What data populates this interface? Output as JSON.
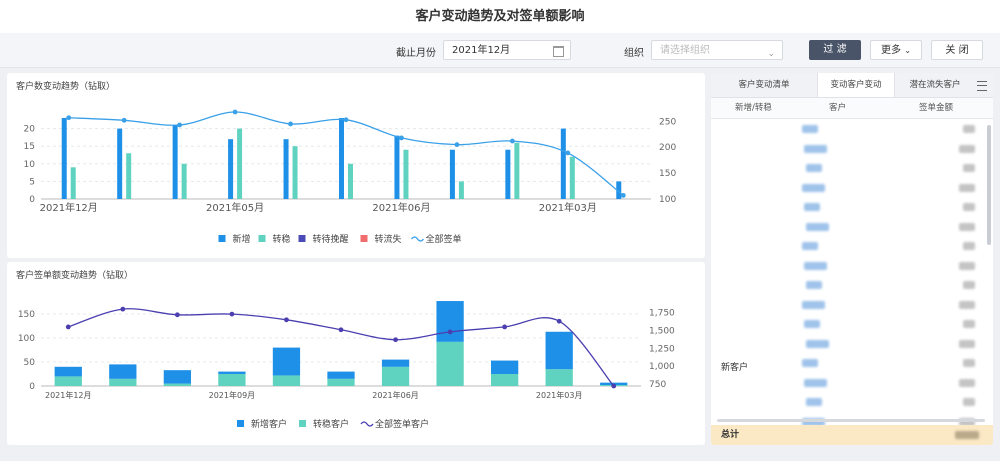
{
  "page_title": "客户变动趋势及对签单额影响",
  "filters": {
    "end_month_label": "截止月份",
    "end_month_value": "2021年12月",
    "org_label": "组织",
    "org_placeholder": "请选择组织",
    "filter_button": "过 滤",
    "more_button": "更多",
    "close_button": "关 闭"
  },
  "chart1": {
    "title": "客户数变动趋势（钻取）",
    "chart_data": {
      "type": "bar",
      "categories": [
        "2021年12月",
        "",
        "",
        "2021年05月",
        "",
        "",
        "2021年06月",
        "",
        "",
        "2021年03月",
        ""
      ],
      "series": [
        {
          "name": "新增",
          "color": "#1e90e8",
          "axis": "left",
          "values": [
            23,
            20,
            21,
            17,
            17,
            23,
            18,
            14,
            14,
            20,
            5
          ]
        },
        {
          "name": "转稳",
          "color": "#5fd3c0",
          "axis": "left",
          "values": [
            9,
            13,
            10,
            20,
            15,
            10,
            14,
            5,
            16,
            12,
            0
          ]
        },
        {
          "name": "转待挽醒",
          "color": "#4b4bb8",
          "axis": "left",
          "values": [
            0,
            0,
            0,
            0,
            0,
            0,
            0,
            0,
            0,
            0,
            0
          ]
        },
        {
          "name": "转流失",
          "color": "#f06d6d",
          "axis": "left",
          "values": [
            0,
            0,
            0,
            0,
            0,
            0,
            0,
            0,
            0,
            0,
            0
          ]
        },
        {
          "name": "全部签单",
          "color": "#3aa0e8",
          "type": "line",
          "axis": "right",
          "values": [
            257,
            252,
            243,
            268,
            245,
            253,
            218,
            205,
            212,
            189,
            107
          ]
        }
      ],
      "yticks_left": [
        "0",
        "5",
        "10",
        "15",
        "20"
      ],
      "yticks_right": [
        "100",
        "150",
        "200",
        "250"
      ],
      "ylim_left": [
        0,
        25
      ],
      "ylim_right": [
        100,
        270
      ],
      "grid": true,
      "legend_placement": "bottom"
    }
  },
  "chart2": {
    "title": "客户签单额变动趋势（钻取）",
    "chart_data": {
      "type": "bar",
      "stacked": true,
      "categories": [
        "2021年12月",
        "",
        "",
        "2021年09月",
        "",
        "",
        "2021年06月",
        "",
        "",
        "2021年03月",
        ""
      ],
      "series": [
        {
          "name": "新增客户",
          "color": "#1e90e8",
          "axis": "left",
          "values": [
            20,
            30,
            28,
            5,
            58,
            15,
            15,
            85,
            28,
            78,
            5
          ]
        },
        {
          "name": "转稳客户",
          "color": "#5fd3c0",
          "axis": "left",
          "values": [
            20,
            15,
            5,
            25,
            22,
            15,
            40,
            92,
            25,
            35,
            2
          ]
        },
        {
          "name": "全部签单客户",
          "color": "#4b3fb0",
          "type": "line",
          "axis": "right",
          "values": [
            1550,
            1800,
            1720,
            1730,
            1650,
            1510,
            1370,
            1480,
            1550,
            1630,
            720
          ]
        }
      ],
      "yticks_left": [
        "0",
        "50",
        "100",
        "150"
      ],
      "yticks_right": [
        "750",
        "1,000",
        "1,250",
        "1,500",
        "1,750"
      ],
      "ylim_left": [
        0,
        175
      ],
      "ylim_right": [
        720,
        1900
      ],
      "grid": true,
      "legend_placement": "bottom"
    }
  },
  "right_panel": {
    "tabs": [
      "客户变动清单",
      "变动客户变动",
      "潜在流失客户"
    ],
    "active_tab": 1,
    "columns": [
      "新增/转稳",
      "客户",
      "签单金额"
    ],
    "row_group_label": "新客户",
    "total_label": "总计"
  }
}
